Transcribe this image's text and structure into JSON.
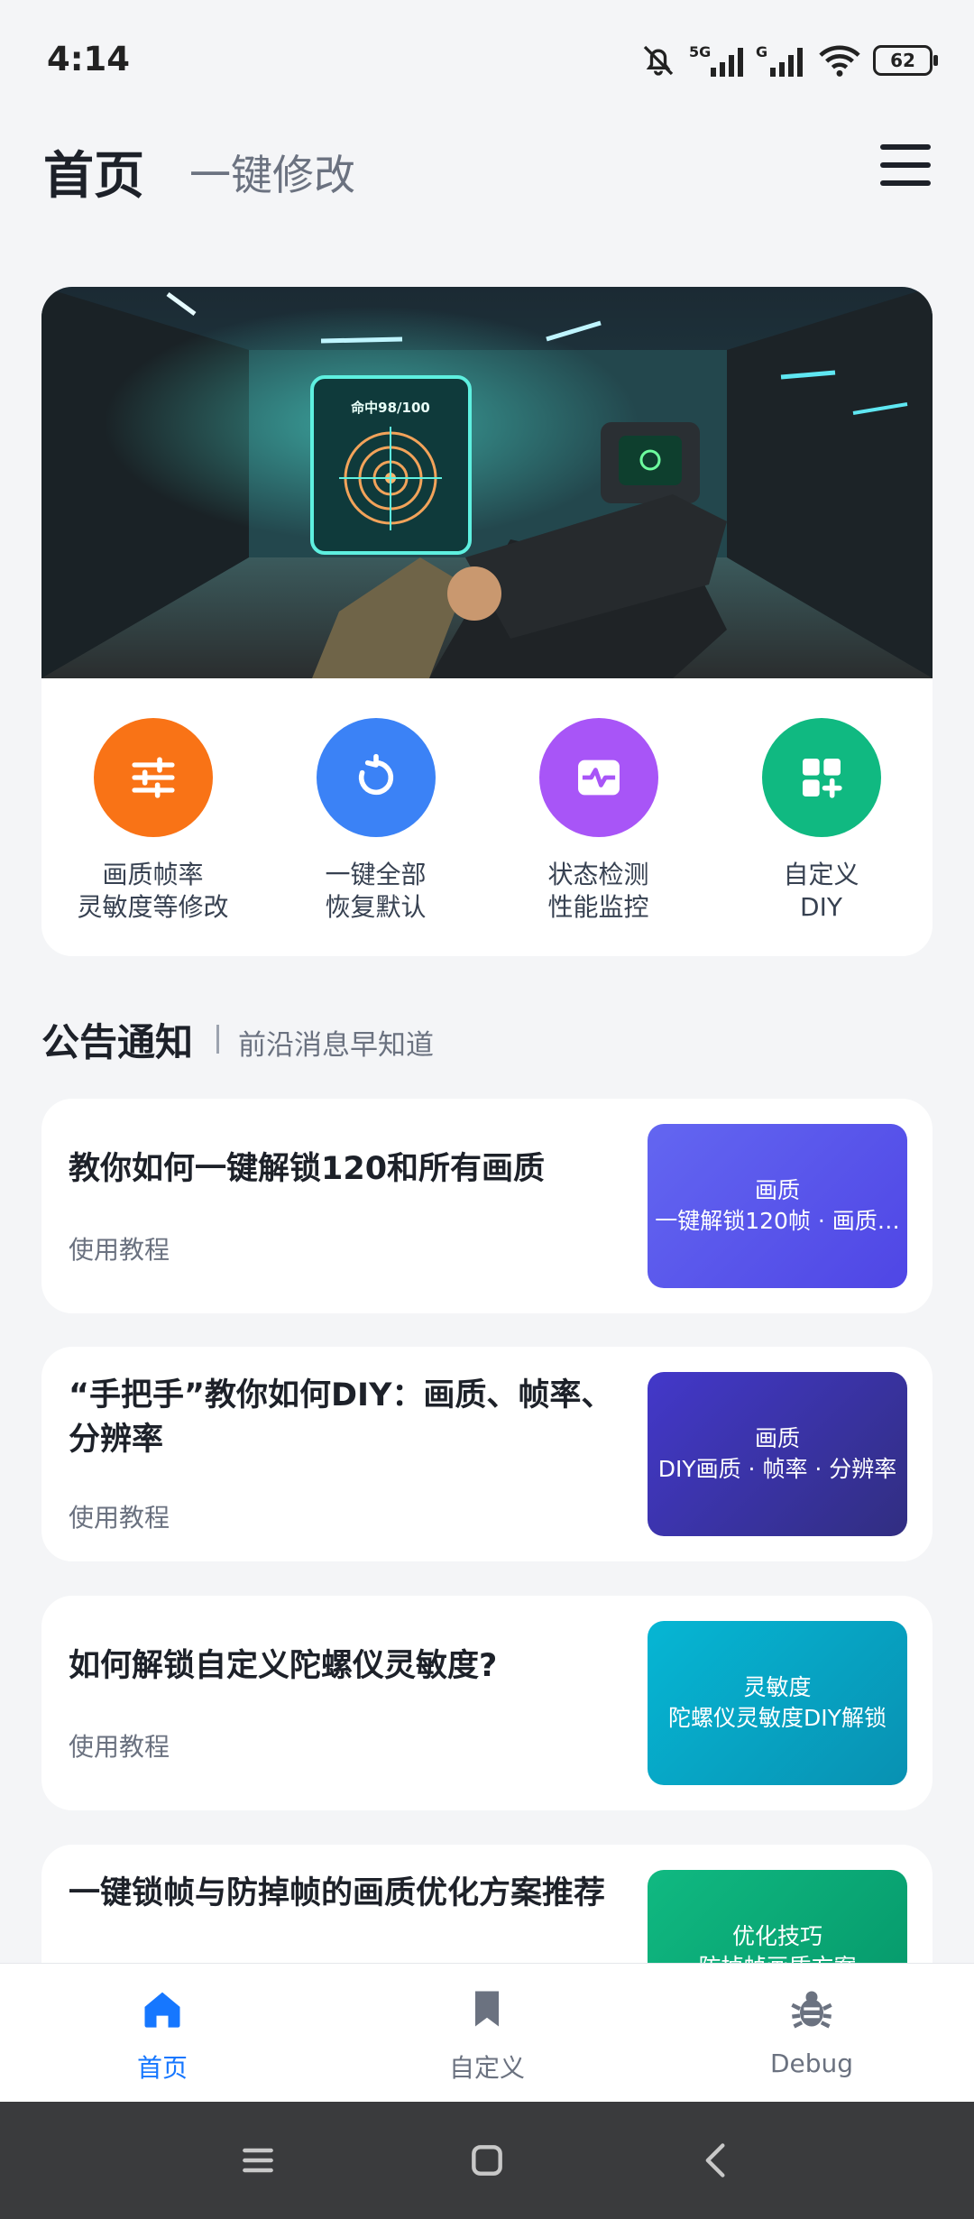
{
  "status_bar": {
    "time": "4:14",
    "battery": "62"
  },
  "header": {
    "title": "首页",
    "subtitle": "一键修改"
  },
  "actions": [
    {
      "line1": "画质帧率",
      "line2": "灵敏度等修改",
      "color": "#f97316",
      "icon": "sliders-icon"
    },
    {
      "line1": "一键全部",
      "line2": "恢复默认",
      "color": "#3b82f6",
      "icon": "restore-icon"
    },
    {
      "line1": "状态检测",
      "line2": "性能监控",
      "color": "#a855f7",
      "icon": "monitor-icon"
    },
    {
      "line1": "自定义",
      "line2": "DIY",
      "color": "#10b981",
      "icon": "grid-plus-icon"
    }
  ],
  "hero": {
    "target_text": "命中98/100"
  },
  "section": {
    "title": "公告通知",
    "subtitle": "前沿消息早知道"
  },
  "articles": [
    {
      "title": "教你如何一键解锁120和所有画质",
      "tag": "使用教程",
      "thumb_title": "画质",
      "thumb_sub": "一键解锁120帧 · 画质…",
      "color_from": "#6366f1",
      "color_to": "#4f46e5"
    },
    {
      "title": "“手把手”教你如何DIY：画质、帧率、分辨率",
      "tag": "使用教程",
      "thumb_title": "画质",
      "thumb_sub": "DIY画质 · 帧率 · 分辨率",
      "color_from": "#4338ca",
      "color_to": "#312e81"
    },
    {
      "title": "如何解锁自定义陀螺仪灵敏度?",
      "tag": "使用教程",
      "thumb_title": "灵敏度",
      "thumb_sub": "陀螺仪灵敏度DIY解锁",
      "color_from": "#06b6d4",
      "color_to": "#0891b2"
    },
    {
      "title": "一键锁帧与防掉帧的画质优化方案推荐",
      "tag": "",
      "thumb_title": "优化技巧",
      "thumb_sub": "防掉帧画质方案",
      "color_from": "#10b981",
      "color_to": "#059669"
    }
  ],
  "bottom_nav": [
    {
      "label": "首页",
      "icon": "home-icon",
      "active": true
    },
    {
      "label": "自定义",
      "icon": "bookmark-icon",
      "active": false
    },
    {
      "label": "Debug",
      "icon": "bug-icon",
      "active": false
    }
  ],
  "colors": {
    "active": "#1677ff",
    "inactive": "#6b7280"
  }
}
